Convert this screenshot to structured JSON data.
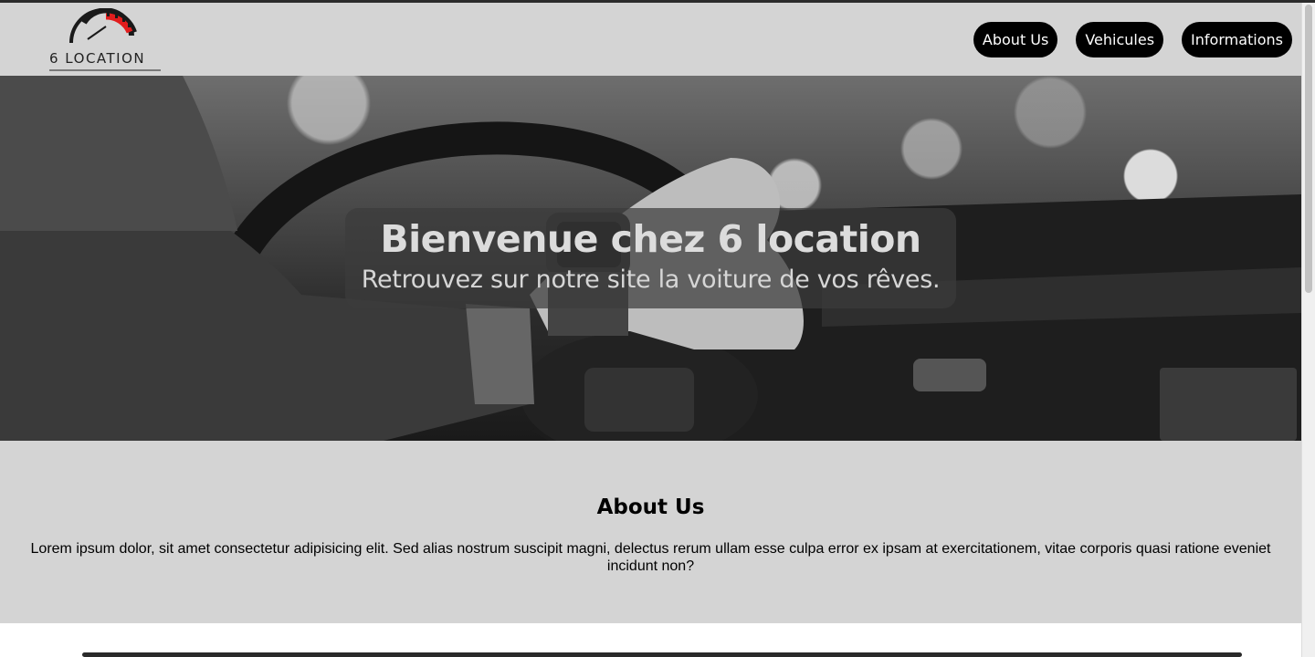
{
  "logo": {
    "text": "6 LOCATION",
    "icon": "speedometer-icon",
    "accent_color": "#e11d1d"
  },
  "nav": {
    "items": [
      {
        "label": "About Us"
      },
      {
        "label": "Vehicules"
      },
      {
        "label": "Informations"
      }
    ]
  },
  "hero": {
    "title": "Bienvenue chez 6 location",
    "subtitle": "Retrouvez sur notre site la voiture de vos rêves."
  },
  "about": {
    "title": "About Us",
    "text": "Lorem ipsum dolor, sit amet consectetur adipisicing elit. Sed alias nostrum suscipit magni, delectus rerum ullam esse culpa error ex ipsam at exercitationem, vitae corporis quasi ratione eveniet incidunt non?"
  },
  "colors": {
    "header_bg": "#d4d4d4",
    "nav_button_bg": "#000000",
    "nav_button_text": "#ffffff"
  }
}
